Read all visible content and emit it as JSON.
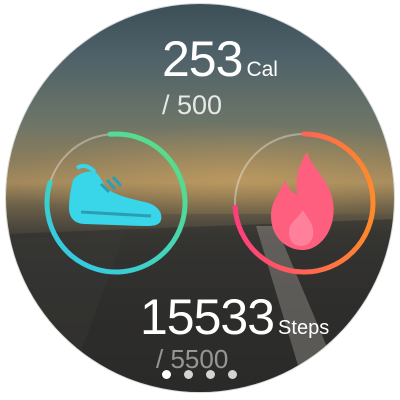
{
  "calories": {
    "value": "253",
    "unit": "Cal",
    "goal": "/ 500",
    "progress": 0.51
  },
  "steps": {
    "value": "15533",
    "unit": "Steps",
    "goal": "/ 5500",
    "progress": 1.0
  },
  "pager": {
    "page_count": 4,
    "active_page": 1
  },
  "icons": {
    "left": "sneaker-icon",
    "right": "flame-icon"
  },
  "colors": {
    "steps_ring_start": "#2ec8f0",
    "steps_ring_end": "#5ee07a",
    "calorie_ring_start": "#ff3d7f",
    "calorie_ring_end": "#ff8a2a",
    "sneaker": "#39d6ea",
    "flame": "#ff5f7e"
  }
}
